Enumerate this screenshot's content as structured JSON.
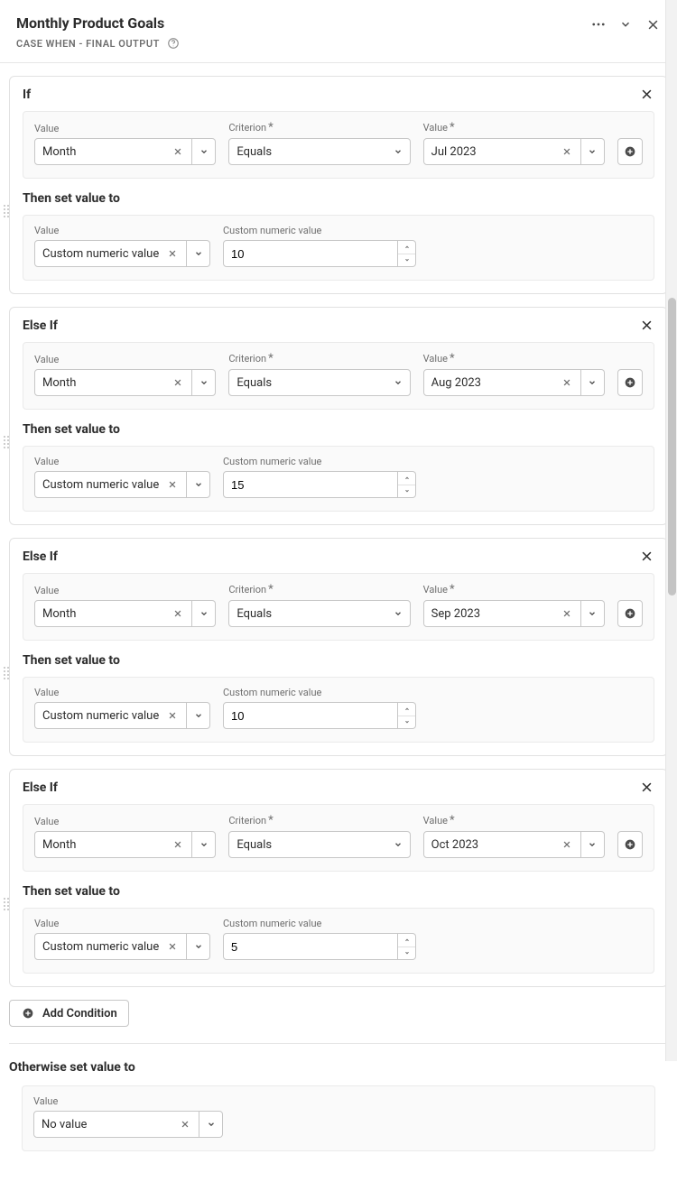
{
  "header": {
    "title": "Monthly Product Goals",
    "subtitle": "CASE WHEN - FINAL OUTPUT"
  },
  "labels": {
    "value": "Value",
    "criterion": "Criterion",
    "custom_numeric": "Custom numeric value",
    "then": "Then set value to",
    "add_condition": "Add Condition",
    "otherwise": "Otherwise set value to"
  },
  "blocks": [
    {
      "title": "If",
      "cond": {
        "field": "Month",
        "criterion": "Equals",
        "value": "Jul 2023"
      },
      "then": {
        "type": "Custom numeric value",
        "num": "10"
      }
    },
    {
      "title": "Else If",
      "cond": {
        "field": "Month",
        "criterion": "Equals",
        "value": "Aug 2023"
      },
      "then": {
        "type": "Custom numeric value",
        "num": "15"
      }
    },
    {
      "title": "Else If",
      "cond": {
        "field": "Month",
        "criterion": "Equals",
        "value": "Sep 2023"
      },
      "then": {
        "type": "Custom numeric value",
        "num": "10"
      }
    },
    {
      "title": "Else If",
      "cond": {
        "field": "Month",
        "criterion": "Equals",
        "value": "Oct 2023"
      },
      "then": {
        "type": "Custom numeric value",
        "num": "5"
      }
    }
  ],
  "otherwise": {
    "value": "No value"
  }
}
